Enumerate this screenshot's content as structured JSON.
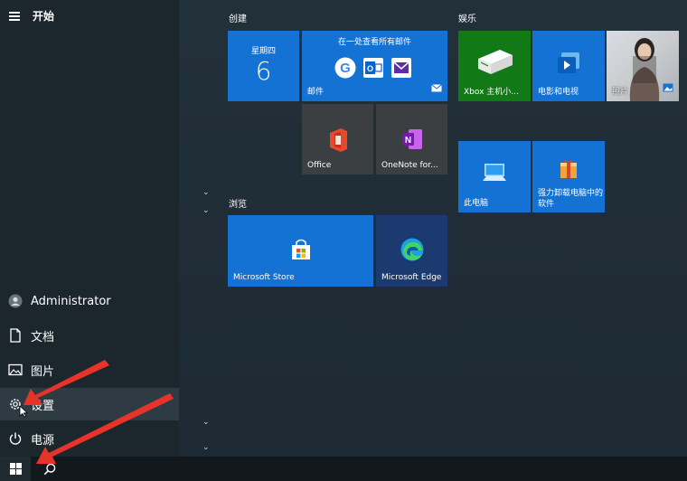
{
  "start_menu": {
    "title": "开始",
    "user": "Administrator",
    "items": [
      {
        "label": "文档",
        "icon": "document-icon"
      },
      {
        "label": "图片",
        "icon": "pictures-icon"
      },
      {
        "label": "设置",
        "icon": "gear-icon"
      },
      {
        "label": "电源",
        "icon": "power-icon"
      }
    ]
  },
  "sections": {
    "create": "创建",
    "entertainment": "娱乐",
    "browse": "浏览"
  },
  "tiles": {
    "calendar": {
      "day_name": "星期四",
      "day_num": "6"
    },
    "mail": {
      "headline": "在一处查看所有邮件",
      "label": "邮件"
    },
    "office": {
      "label": "Office"
    },
    "onenote": {
      "label": "OneNote for..."
    },
    "xbox": {
      "label": "Xbox 主机小..."
    },
    "movies": {
      "label": "电影和电视"
    },
    "photos": {
      "label": "照片"
    },
    "this_pc": {
      "label": "此电脑"
    },
    "uninstaller": {
      "label": "强力卸载电脑中的软件"
    },
    "store": {
      "label": "Microsoft Store"
    },
    "edge": {
      "label": "Microsoft Edge"
    }
  },
  "colors": {
    "tile_blue": "#1372d3",
    "tile_gray": "#3b3f42",
    "tile_green": "#117a17",
    "annotation_arrow": "#e8332a"
  }
}
